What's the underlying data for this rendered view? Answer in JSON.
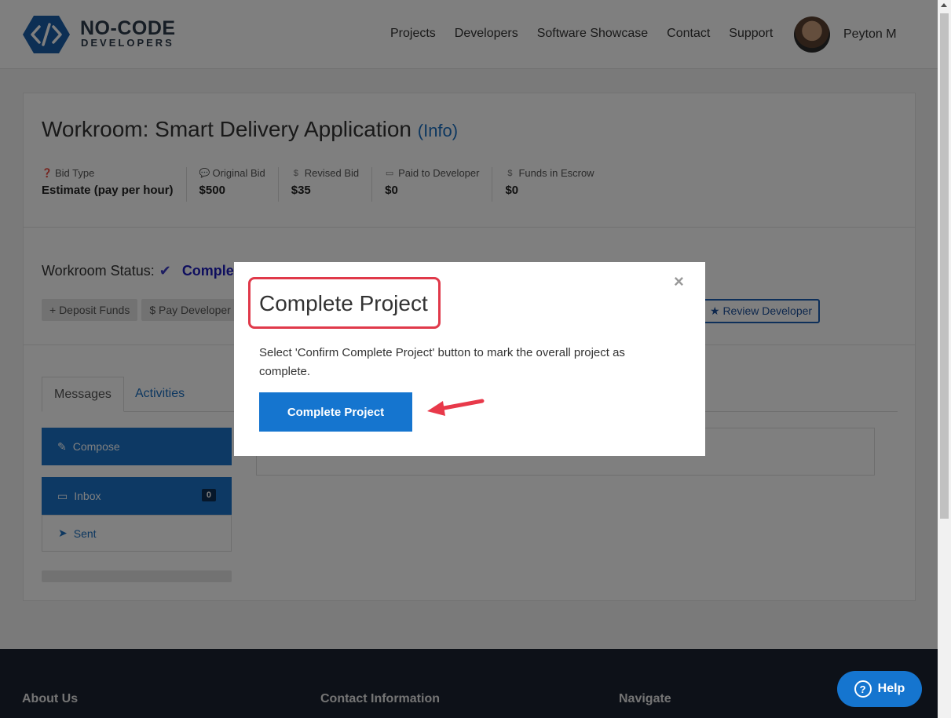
{
  "header": {
    "logo_line1": "NO-CODE",
    "logo_line2": "DEVELOPERS",
    "nav": [
      "Projects",
      "Developers",
      "Software Showcase",
      "Contact",
      "Support"
    ],
    "username": "Peyton M"
  },
  "workroom": {
    "title": "Workroom: Smart Delivery Application",
    "info_link": "(Info)",
    "stats": [
      {
        "label": "Bid Type",
        "value": "Estimate (pay per hour)",
        "icon": "question-icon"
      },
      {
        "label": "Original Bid",
        "value": "$500",
        "icon": "chat-icon"
      },
      {
        "label": "Revised Bid",
        "value": "$35",
        "icon": "dollar-icon"
      },
      {
        "label": "Paid to Developer",
        "value": "$0",
        "icon": "money-icon"
      },
      {
        "label": "Funds in Escrow",
        "value": "$0",
        "icon": "dollar-icon"
      }
    ],
    "status_label": "Workroom Status:",
    "status_value": "Complete",
    "actions": {
      "deposit": "+ Deposit Funds",
      "pay": "$ Pay Developer",
      "review": "★ Review Developer"
    },
    "tabs": {
      "messages": "Messages",
      "activities": "Activities"
    },
    "mailbox": {
      "compose": "Compose",
      "inbox": "Inbox",
      "inbox_count": "0",
      "sent": "Sent"
    }
  },
  "footer": {
    "about": "About Us",
    "contact": "Contact Information",
    "navigate": "Navigate"
  },
  "modal": {
    "title": "Complete Project",
    "close": "×",
    "text": "Select 'Confirm Complete Project' button to mark the overall project as complete.",
    "button": "Complete Project"
  },
  "help": {
    "label": "Help"
  },
  "colors": {
    "primary": "#1575cf",
    "highlight": "#e0394a",
    "footer": "#1a2230"
  }
}
